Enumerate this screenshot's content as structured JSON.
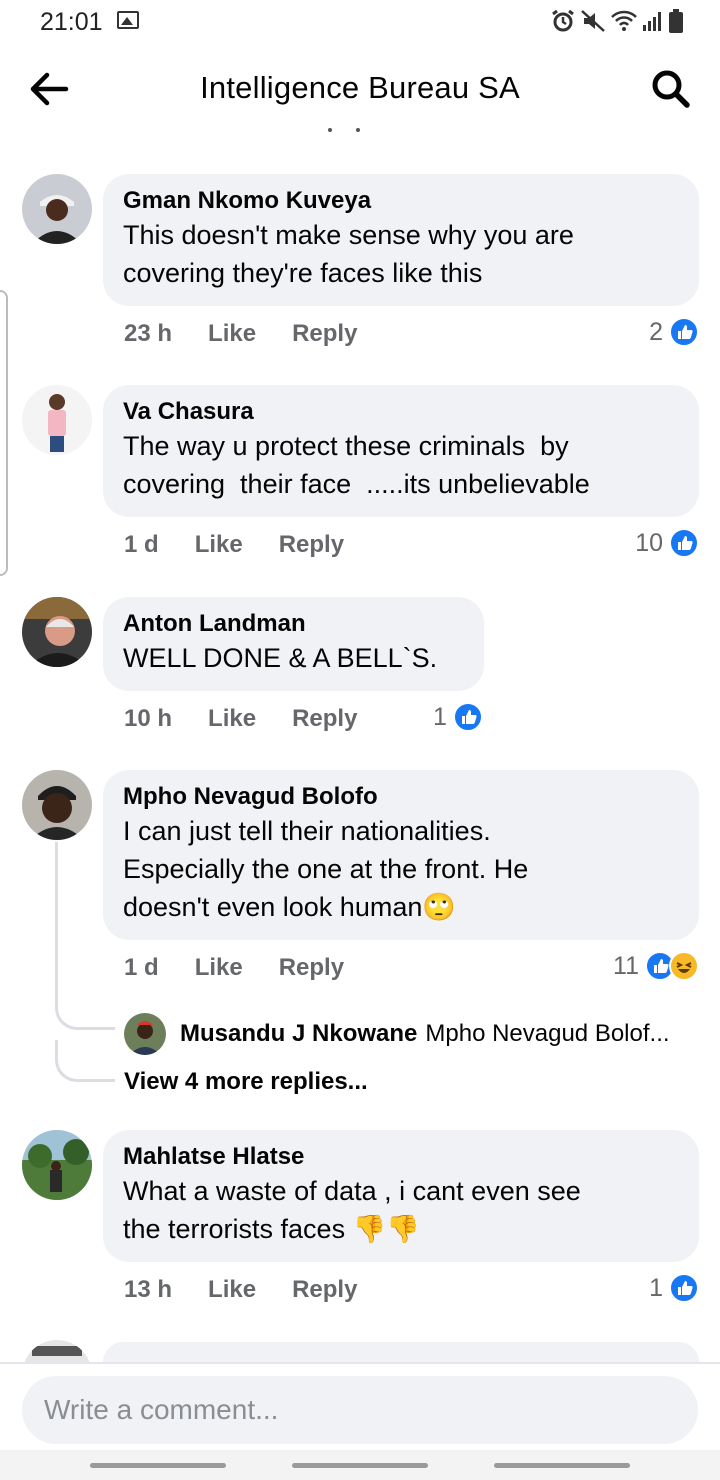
{
  "status_bar": {
    "time": "21:01",
    "icons": [
      "gallery-icon",
      "alarm-icon",
      "mute-icon",
      "wifi-icon",
      "signal-icon",
      "battery-icon"
    ]
  },
  "header": {
    "title": "Intelligence Bureau SA",
    "back_icon": "arrow-left-icon",
    "search_icon": "search-icon"
  },
  "comments": [
    {
      "author": "Gman Nkomo Kuveya",
      "lines": [
        "This doesn't make sense why you are",
        "covering they're faces like this"
      ],
      "time": "23 h",
      "like_label": "Like",
      "reply_label": "Reply",
      "reaction_count": "2",
      "reactions": [
        "like"
      ]
    },
    {
      "author": "Va Chasura",
      "lines": [
        "The way u protect these criminals  by",
        "covering  their face  .....its unbelievable"
      ],
      "time": "1 d",
      "like_label": "Like",
      "reply_label": "Reply",
      "reaction_count": "10",
      "reactions": [
        "like"
      ]
    },
    {
      "author": "Anton Landman",
      "lines": [
        "WELL DONE & A BELL`S."
      ],
      "time": "10 h",
      "like_label": "Like",
      "reply_label": "Reply",
      "reaction_count": "1",
      "reactions": [
        "like"
      ]
    },
    {
      "author": "Mpho Nevagud Bolofo",
      "lines": [
        "I can just tell their nationalities.",
        "Especially the one at the front. He",
        "doesn't even look human🙄"
      ],
      "time": "1 d",
      "like_label": "Like",
      "reply_label": "Reply",
      "reaction_count": "11",
      "reactions": [
        "like",
        "haha"
      ],
      "reply_preview": {
        "author": "Musandu J Nkowane",
        "text": "Mpho Nevagud Bolof..."
      },
      "view_more": "View 4 more replies..."
    },
    {
      "author": "Mahlatse Hlatse",
      "lines": [
        "What a waste of data , i cant even see",
        "the terrorists faces 👎👎"
      ],
      "time": "13 h",
      "like_label": "Like",
      "reply_label": "Reply",
      "reaction_count": "1",
      "reactions": [
        "like"
      ]
    }
  ],
  "composer": {
    "placeholder": "Write a comment..."
  },
  "colors": {
    "bubble": "#f0f2f5",
    "meta_text": "#65676b",
    "like_blue": "#1877f2",
    "haha_yellow": "#f7b928"
  }
}
